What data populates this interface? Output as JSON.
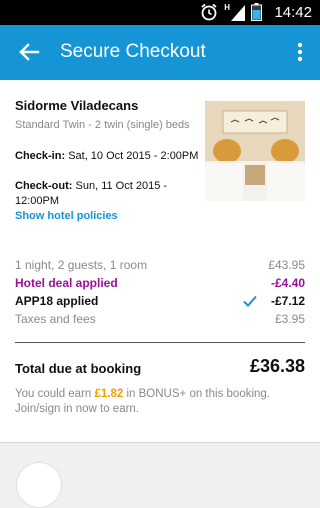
{
  "status": {
    "time": "14:42",
    "network_letter": "H"
  },
  "appbar": {
    "title": "Secure Checkout"
  },
  "hotel": {
    "name": "Sidorme Viladecans",
    "room_type": "Standard Twin - 2 twin (single) beds",
    "checkin_label": "Check-in:",
    "checkin_value": "Sat, 10 Oct 2015 - 2:00PM",
    "checkout_label": "Check-out:",
    "checkout_value": "Sun, 11 Oct 2015 - 12:00PM",
    "policies_link": "Show hotel policies"
  },
  "pricing": {
    "summary_label": "1 night, 2 guests, 1 room",
    "summary_value": "£43.95",
    "deal_label": "Hotel deal applied",
    "deal_value": "-£4.40",
    "coupon_label": "APP18 applied",
    "coupon_value": "-£7.12",
    "taxes_label": "Taxes and fees",
    "taxes_value": "£3.95",
    "total_label": "Total due at booking",
    "total_value": "£36.38"
  },
  "earn": {
    "prefix": "You could earn ",
    "amount": "£1.82",
    "suffix": " in BONUS+ on this booking. Join/sign in now to earn."
  },
  "colors": {
    "appbar": "#1595d6",
    "deal": "#9b0f9b",
    "earn_amount": "#f5a000",
    "link": "#1595d6"
  }
}
